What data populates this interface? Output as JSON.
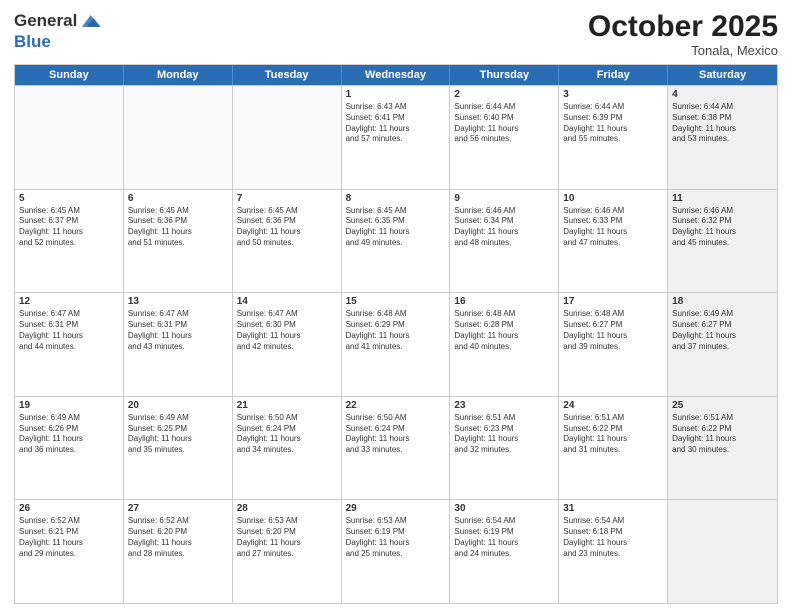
{
  "header": {
    "logo_line1": "General",
    "logo_line2": "Blue",
    "month": "October 2025",
    "location": "Tonala, Mexico"
  },
  "days_of_week": [
    "Sunday",
    "Monday",
    "Tuesday",
    "Wednesday",
    "Thursday",
    "Friday",
    "Saturday"
  ],
  "rows": [
    [
      {
        "day": "",
        "info": "",
        "empty": true
      },
      {
        "day": "",
        "info": "",
        "empty": true
      },
      {
        "day": "",
        "info": "",
        "empty": true
      },
      {
        "day": "1",
        "info": "Sunrise: 6:43 AM\nSunset: 6:41 PM\nDaylight: 11 hours\nand 57 minutes."
      },
      {
        "day": "2",
        "info": "Sunrise: 6:44 AM\nSunset: 6:40 PM\nDaylight: 11 hours\nand 56 minutes."
      },
      {
        "day": "3",
        "info": "Sunrise: 6:44 AM\nSunset: 6:39 PM\nDaylight: 11 hours\nand 55 minutes."
      },
      {
        "day": "4",
        "info": "Sunrise: 6:44 AM\nSunset: 6:38 PM\nDaylight: 11 hours\nand 53 minutes.",
        "shaded": true
      }
    ],
    [
      {
        "day": "5",
        "info": "Sunrise: 6:45 AM\nSunset: 6:37 PM\nDaylight: 11 hours\nand 52 minutes."
      },
      {
        "day": "6",
        "info": "Sunrise: 6:45 AM\nSunset: 6:36 PM\nDaylight: 11 hours\nand 51 minutes."
      },
      {
        "day": "7",
        "info": "Sunrise: 6:45 AM\nSunset: 6:36 PM\nDaylight: 11 hours\nand 50 minutes."
      },
      {
        "day": "8",
        "info": "Sunrise: 6:45 AM\nSunset: 6:35 PM\nDaylight: 11 hours\nand 49 minutes."
      },
      {
        "day": "9",
        "info": "Sunrise: 6:46 AM\nSunset: 6:34 PM\nDaylight: 11 hours\nand 48 minutes."
      },
      {
        "day": "10",
        "info": "Sunrise: 6:46 AM\nSunset: 6:33 PM\nDaylight: 11 hours\nand 47 minutes."
      },
      {
        "day": "11",
        "info": "Sunrise: 6:46 AM\nSunset: 6:32 PM\nDaylight: 11 hours\nand 45 minutes.",
        "shaded": true
      }
    ],
    [
      {
        "day": "12",
        "info": "Sunrise: 6:47 AM\nSunset: 6:31 PM\nDaylight: 11 hours\nand 44 minutes."
      },
      {
        "day": "13",
        "info": "Sunrise: 6:47 AM\nSunset: 6:31 PM\nDaylight: 11 hours\nand 43 minutes."
      },
      {
        "day": "14",
        "info": "Sunrise: 6:47 AM\nSunset: 6:30 PM\nDaylight: 11 hours\nand 42 minutes."
      },
      {
        "day": "15",
        "info": "Sunrise: 6:48 AM\nSunset: 6:29 PM\nDaylight: 11 hours\nand 41 minutes."
      },
      {
        "day": "16",
        "info": "Sunrise: 6:48 AM\nSunset: 6:28 PM\nDaylight: 11 hours\nand 40 minutes."
      },
      {
        "day": "17",
        "info": "Sunrise: 6:48 AM\nSunset: 6:27 PM\nDaylight: 11 hours\nand 39 minutes."
      },
      {
        "day": "18",
        "info": "Sunrise: 6:49 AM\nSunset: 6:27 PM\nDaylight: 11 hours\nand 37 minutes.",
        "shaded": true
      }
    ],
    [
      {
        "day": "19",
        "info": "Sunrise: 6:49 AM\nSunset: 6:26 PM\nDaylight: 11 hours\nand 36 minutes."
      },
      {
        "day": "20",
        "info": "Sunrise: 6:49 AM\nSunset: 6:25 PM\nDaylight: 11 hours\nand 35 minutes."
      },
      {
        "day": "21",
        "info": "Sunrise: 6:50 AM\nSunset: 6:24 PM\nDaylight: 11 hours\nand 34 minutes."
      },
      {
        "day": "22",
        "info": "Sunrise: 6:50 AM\nSunset: 6:24 PM\nDaylight: 11 hours\nand 33 minutes."
      },
      {
        "day": "23",
        "info": "Sunrise: 6:51 AM\nSunset: 6:23 PM\nDaylight: 11 hours\nand 32 minutes."
      },
      {
        "day": "24",
        "info": "Sunrise: 6:51 AM\nSunset: 6:22 PM\nDaylight: 11 hours\nand 31 minutes."
      },
      {
        "day": "25",
        "info": "Sunrise: 6:51 AM\nSunset: 6:22 PM\nDaylight: 11 hours\nand 30 minutes.",
        "shaded": true
      }
    ],
    [
      {
        "day": "26",
        "info": "Sunrise: 6:52 AM\nSunset: 6:21 PM\nDaylight: 11 hours\nand 29 minutes."
      },
      {
        "day": "27",
        "info": "Sunrise: 6:52 AM\nSunset: 6:20 PM\nDaylight: 11 hours\nand 28 minutes."
      },
      {
        "day": "28",
        "info": "Sunrise: 6:53 AM\nSunset: 6:20 PM\nDaylight: 11 hours\nand 27 minutes."
      },
      {
        "day": "29",
        "info": "Sunrise: 6:53 AM\nSunset: 6:19 PM\nDaylight: 11 hours\nand 25 minutes."
      },
      {
        "day": "30",
        "info": "Sunrise: 6:54 AM\nSunset: 6:19 PM\nDaylight: 11 hours\nand 24 minutes."
      },
      {
        "day": "31",
        "info": "Sunrise: 6:54 AM\nSunset: 6:18 PM\nDaylight: 11 hours\nand 23 minutes."
      },
      {
        "day": "",
        "info": "",
        "empty": true,
        "shaded": true
      }
    ]
  ]
}
